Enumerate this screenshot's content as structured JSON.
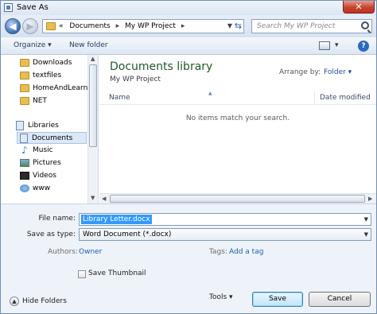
{
  "window": {
    "title": "Save As",
    "close_label": "✕"
  },
  "nav": {
    "back_label": "◀",
    "forward_label": "▶",
    "address_prefix": "«",
    "address_parts": [
      "Documents",
      "My WP Project"
    ],
    "search_placeholder": "Search My WP Project"
  },
  "toolbar": {
    "organize_label": "Organize ▾",
    "new_folder_label": "New folder",
    "help_label": "?"
  },
  "sidebar": {
    "folders": [
      {
        "label": "Downloads",
        "icon": "folder-icon"
      },
      {
        "label": "textfiles",
        "icon": "folder-icon"
      },
      {
        "label": "HomeAndLearn",
        "icon": "folder-icon"
      },
      {
        "label": "NET",
        "icon": "folder-icon"
      }
    ],
    "libraries_label": "Libraries",
    "libraries": [
      {
        "label": "Documents",
        "icon": "document-library-icon",
        "selected": true
      },
      {
        "label": "Music",
        "icon": "music-icon"
      },
      {
        "label": "Pictures",
        "icon": "pictures-icon"
      },
      {
        "label": "Videos",
        "icon": "videos-icon"
      },
      {
        "label": "www",
        "icon": "homegroup-icon"
      }
    ]
  },
  "main": {
    "library_title": "Documents library",
    "library_subtitle": "My WP Project",
    "arrange_label": "Arrange by:",
    "arrange_value": "Folder ▾",
    "columns": {
      "name": "Name",
      "date": "Date modified"
    },
    "empty_message": "No items match your search."
  },
  "form": {
    "filename_label": "File name:",
    "filename_value": "Library Letter.docx",
    "savetype_label": "Save as type:",
    "savetype_value": "Word Document (*.docx)",
    "authors_label": "Authors:",
    "authors_value": "Owner",
    "tags_label": "Tags:",
    "tags_value": "Add a tag",
    "thumbnail_label": "Save Thumbnail",
    "thumbnail_checked": false
  },
  "footer": {
    "hide_folders_label": "Hide Folders",
    "tools_label": "Tools ▾",
    "save_label": "Save",
    "cancel_label": "Cancel"
  },
  "colors": {
    "library_title": "#1e5a2b",
    "link": "#1e5fb3",
    "selection": "#3399ff"
  }
}
